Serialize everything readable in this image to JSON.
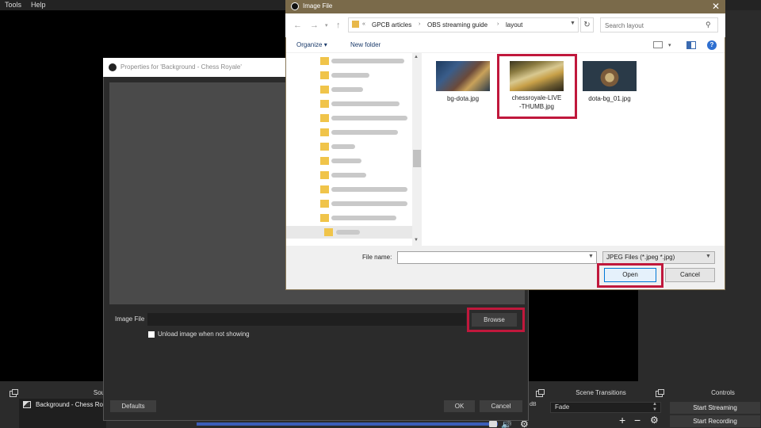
{
  "menubar": {
    "items": [
      "Tools",
      "Help"
    ]
  },
  "docks": {
    "sources_title": "Sou",
    "scene_transitions_title": "Scene Transitions",
    "controls_title": "Controls"
  },
  "sources": {
    "items": [
      {
        "label": "Background - Chess Roy"
      }
    ]
  },
  "mixer": {
    "db_fragment": "dB"
  },
  "transitions": {
    "selected": "Fade"
  },
  "controls": {
    "start_streaming": "Start Streaming",
    "start_recording": "Start Recording"
  },
  "properties_dialog": {
    "title": "Properties for 'Background - Chess Royale'",
    "image_file_label": "Image File",
    "image_file_value": "",
    "browse_label": "Browse",
    "unload_label": "Unload image when not showing",
    "unload_checked": false,
    "defaults_label": "Defaults",
    "ok_label": "OK",
    "cancel_label": "Cancel"
  },
  "file_dialog": {
    "title": "Image File",
    "breadcrumb": [
      "GPCB articles",
      "OBS streaming guide",
      "layout"
    ],
    "breadcrumb_prefix": "«",
    "search_placeholder": "Search layout",
    "organize_label": "Organize",
    "new_folder_label": "New folder",
    "help_glyph": "?",
    "files": [
      {
        "name": "bg-dota.jpg",
        "selected": false
      },
      {
        "name": "chessroyale-LIVE-THUMB.jpg",
        "name_line1": "chessroyale-LIVE",
        "name_line2": "-THUMB.jpg",
        "selected": true
      },
      {
        "name": "dota-bg_01.jpg",
        "selected": false
      }
    ],
    "filename_label": "File name:",
    "filename_value": "",
    "filetype_label": "JPEG Files (*.jpeg *.jpg)",
    "open_label": "Open",
    "cancel_label": "Cancel"
  },
  "colors": {
    "highlight": "#c0183c",
    "obs_bg": "#2b2b2b",
    "dialog_titlebar": "#7a6a4a",
    "accent_blue": "#0078d7"
  }
}
